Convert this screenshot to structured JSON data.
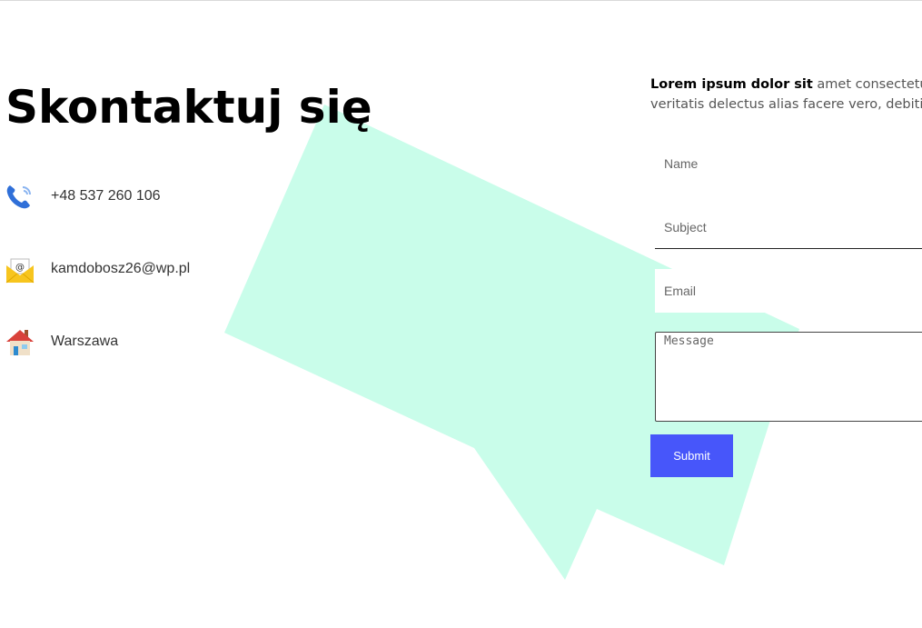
{
  "title": "Skontaktuj się",
  "contacts": [
    {
      "icon": "phone-icon",
      "text": "+48 537 260 106"
    },
    {
      "icon": "email-envelope-icon",
      "text": "kamdobosz26@wp.pl"
    },
    {
      "icon": "house-icon",
      "text": "Warszawa"
    }
  ],
  "intro": {
    "bold": "Lorem ipsum dolor sit",
    "rest": " amet consectetu",
    "line2": "veritatis delectus alias facere vero, debitis"
  },
  "form": {
    "name_placeholder": "Name",
    "subject_placeholder": "Subject",
    "email_placeholder": "Email",
    "message_placeholder": "Message",
    "submit_label": "Submit"
  },
  "colors": {
    "bubble": "#c9fdea",
    "submit": "#4756fa"
  }
}
